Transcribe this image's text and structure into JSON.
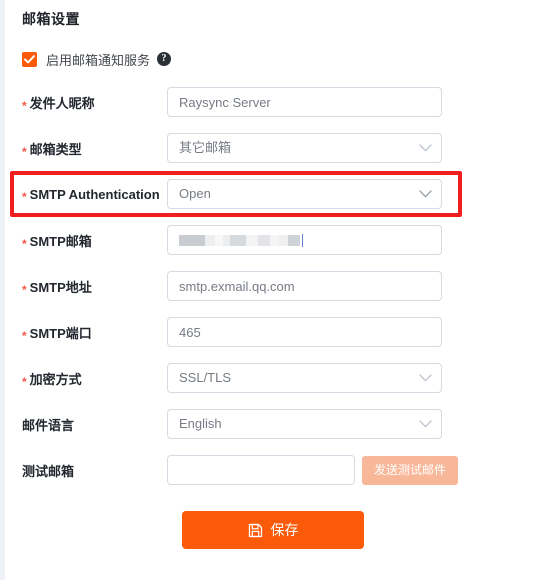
{
  "page": {
    "title": "邮箱设置",
    "accent_color": "#fa5a0a",
    "highlight_color": "#f01e1e",
    "required_color": "#f5554a"
  },
  "enable": {
    "label": "启用邮箱通知服务",
    "checked": true,
    "check_icon": "check-icon",
    "help_icon": "help-question-icon",
    "help_glyph": "?"
  },
  "form": {
    "rows": [
      {
        "label": "发件人昵称",
        "required": true,
        "control": "input",
        "value": "Raysync Server",
        "name": "sender-nickname"
      },
      {
        "label": "邮箱类型",
        "required": true,
        "control": "select",
        "value": "其它邮箱",
        "name": "mailbox-type"
      },
      {
        "label": "SMTP Authentication",
        "required": true,
        "control": "select",
        "value": "Open",
        "name": "smtp-authentication",
        "highlighted": true
      },
      {
        "label": "SMTP邮箱",
        "required": true,
        "control": "masked",
        "value": "",
        "name": "smtp-mailbox"
      },
      {
        "label": "SMTP地址",
        "required": true,
        "control": "input",
        "value": "smtp.exmail.qq.com",
        "name": "smtp-address"
      },
      {
        "label": "SMTP端口",
        "required": true,
        "control": "input",
        "value": "465",
        "name": "smtp-port"
      },
      {
        "label": "加密方式",
        "required": true,
        "control": "select",
        "value": "SSL/TLS",
        "name": "encryption-method"
      },
      {
        "label": "邮件语言",
        "required": false,
        "control": "select",
        "value": "English",
        "name": "mail-language"
      },
      {
        "label": "测试邮箱",
        "required": false,
        "control": "input-with-button",
        "value": "",
        "placeholder": "",
        "button_label": "发送测试邮件",
        "name": "test-mailbox"
      }
    ]
  },
  "save": {
    "label": "保存",
    "icon": "save-floppy-icon"
  }
}
